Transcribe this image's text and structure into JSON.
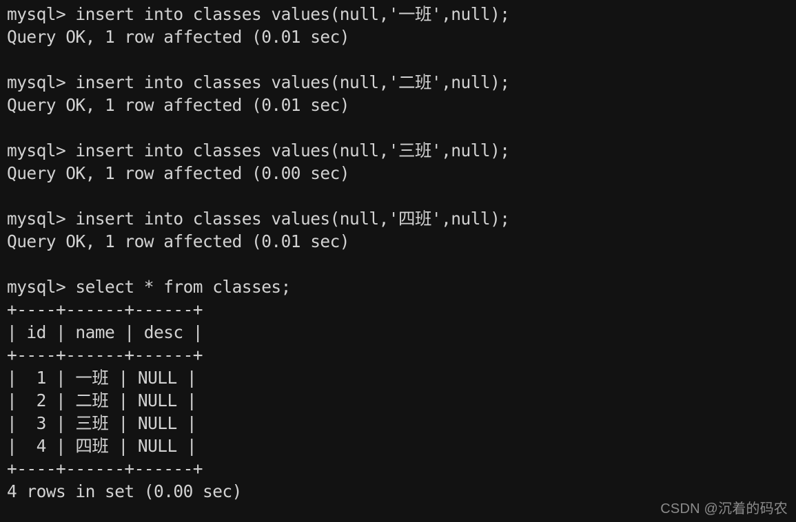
{
  "terminal": {
    "background_color": "#121212",
    "foreground_color": "#d2d2d2",
    "prompt": "mysql>",
    "lines": [
      {
        "id": "insert-1-command",
        "text": "mysql> insert into classes values(null,'一班',null);"
      },
      {
        "id": "insert-1-result",
        "text": "Query OK, 1 row affected (0.01 sec)"
      },
      {
        "id": "blank-1",
        "text": ""
      },
      {
        "id": "insert-2-command",
        "text": "mysql> insert into classes values(null,'二班',null);"
      },
      {
        "id": "insert-2-result",
        "text": "Query OK, 1 row affected (0.01 sec)"
      },
      {
        "id": "blank-2",
        "text": ""
      },
      {
        "id": "insert-3-command",
        "text": "mysql> insert into classes values(null,'三班',null);"
      },
      {
        "id": "insert-3-result",
        "text": "Query OK, 1 row affected (0.00 sec)"
      },
      {
        "id": "blank-3",
        "text": ""
      },
      {
        "id": "insert-4-command",
        "text": "mysql> insert into classes values(null,'四班',null);"
      },
      {
        "id": "insert-4-result",
        "text": "Query OK, 1 row affected (0.01 sec)"
      },
      {
        "id": "blank-4",
        "text": ""
      },
      {
        "id": "select-command",
        "text": "mysql> select * from classes;"
      },
      {
        "id": "table-rule-top",
        "text": "+----+------+------+"
      },
      {
        "id": "table-header-row",
        "text": "| id | name | desc |"
      },
      {
        "id": "table-rule-mid",
        "text": "+----+------+------+"
      },
      {
        "id": "table-row-1",
        "text": "|  1 | 一班 | NULL |"
      },
      {
        "id": "table-row-2",
        "text": "|  2 | 二班 | NULL |"
      },
      {
        "id": "table-row-3",
        "text": "|  3 | 三班 | NULL |"
      },
      {
        "id": "table-row-4",
        "text": "|  4 | 四班 | NULL |"
      },
      {
        "id": "table-rule-bottom",
        "text": "+----+------+------+"
      },
      {
        "id": "select-result",
        "text": "4 rows in set (0.00 sec)"
      }
    ],
    "result_table": {
      "columns": [
        "id",
        "name",
        "desc"
      ],
      "rows": [
        [
          "1",
          "一班",
          "NULL"
        ],
        [
          "2",
          "二班",
          "NULL"
        ],
        [
          "3",
          "三班",
          "NULL"
        ],
        [
          "4",
          "四班",
          "NULL"
        ]
      ],
      "row_count_text": "4 rows in set (0.00 sec)"
    }
  },
  "watermark": {
    "text": "CSDN @沉着的码农",
    "color": "#8b8b8b"
  }
}
